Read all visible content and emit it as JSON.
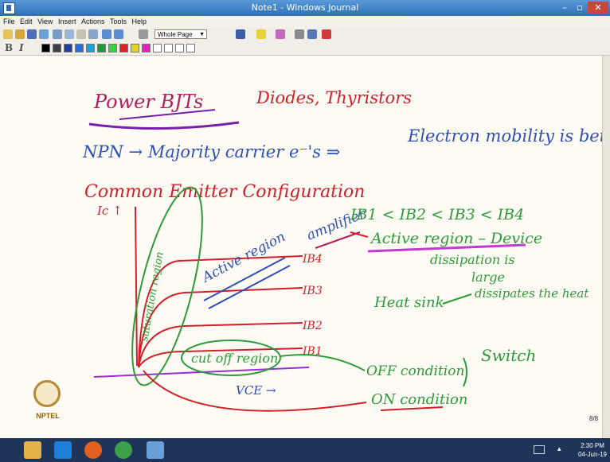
{
  "window": {
    "title": "Note1 - Windows Journal",
    "min": "–",
    "max": "▫",
    "close": "✕"
  },
  "menu": [
    "File",
    "Edit",
    "View",
    "Insert",
    "Actions",
    "Tools",
    "Help"
  ],
  "toolbar": {
    "page_view": "Whole Page"
  },
  "format": {
    "bold": "B",
    "italic": "I"
  },
  "palette": [
    "#000000",
    "#404040",
    "#1f3f9f",
    "#2a6bd9",
    "#1aa0e0",
    "#1e9a3a",
    "#3ad23a",
    "#e02020",
    "#e6d020",
    "#e020c0"
  ],
  "ink": {
    "heading": "Power BJTs",
    "heading_extra": "Diodes, Thyristors",
    "npn_line": "NPN → Majority carrier e⁻'s ⇒",
    "mobility": "Electron mobility is better",
    "config": "Common Emitter Configuration",
    "ic_axis": "Ic ↑",
    "saturation": "saturation region",
    "active": "Active region",
    "amplifier": "amplifier",
    "ib_order": "IB1 < IB2 < IB3 < IB4",
    "active_note": "Active region – Device",
    "dissipation": "dissipation is",
    "large": "large",
    "heatsink": "Heat sink",
    "dissipates": "dissipates the heat",
    "ib4": "IB4",
    "ib3": "IB3",
    "ib2": "IB2",
    "ib1": "IB1",
    "cutoff": "cut off region",
    "off_condition": "OFF condition",
    "switch": "Switch",
    "on_condition": "ON condition",
    "vce": "VCE →"
  },
  "page_indicator": "8/8",
  "logo_text": "NPTEL",
  "taskbar": {
    "time": "2:30 PM",
    "date": "04-Jun-19"
  }
}
